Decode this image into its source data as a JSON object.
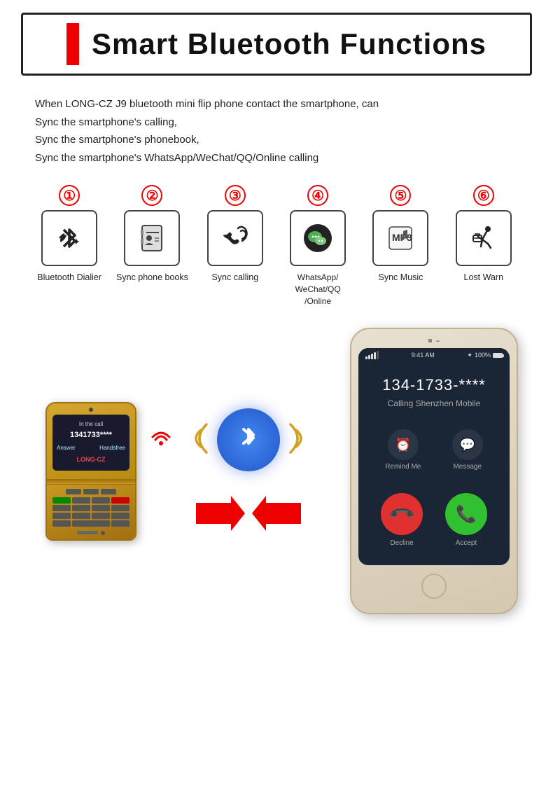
{
  "header": {
    "title": "Smart Bluetooth Functions",
    "border_color": "#222"
  },
  "description": {
    "lines": [
      "When LONG-CZ J9 bluetooth mini flip phone contact the smartphone, can",
      "Sync the smartphone's calling,",
      "Sync the smartphone's phonebook,",
      "Sync the smartphone's WhatsApp/WeChat/QQ/Online calling"
    ]
  },
  "features": [
    {
      "number": "①",
      "label": "Bluetooth Dialier",
      "icon": "📞"
    },
    {
      "number": "②",
      "label": "Sync phone books",
      "icon": "📓"
    },
    {
      "number": "③",
      "label": "Sync calling",
      "icon": "📲"
    },
    {
      "number": "④",
      "label": "WhatsApp/\nWeChat/QQ\n/Online",
      "icon": "💬"
    },
    {
      "number": "⑤",
      "label": "Sync Music",
      "icon": "🎵"
    },
    {
      "number": "⑥",
      "label": "Lost Warn",
      "icon": "🏃"
    }
  ],
  "small_phone": {
    "call_status": "In the call",
    "call_number": "1341733****",
    "btn_answer": "Answer",
    "btn_handsfree": "Handsfree",
    "brand": "LONG-CZ"
  },
  "smartphone": {
    "status_time": "9:41 AM",
    "status_battery": "100%",
    "phone_number": "134-1733-****",
    "calling_text": "Calling Shenzhen Mobile",
    "remind_label": "Remind Me",
    "message_label": "Message",
    "decline_label": "Decline",
    "accept_label": "Accept"
  }
}
